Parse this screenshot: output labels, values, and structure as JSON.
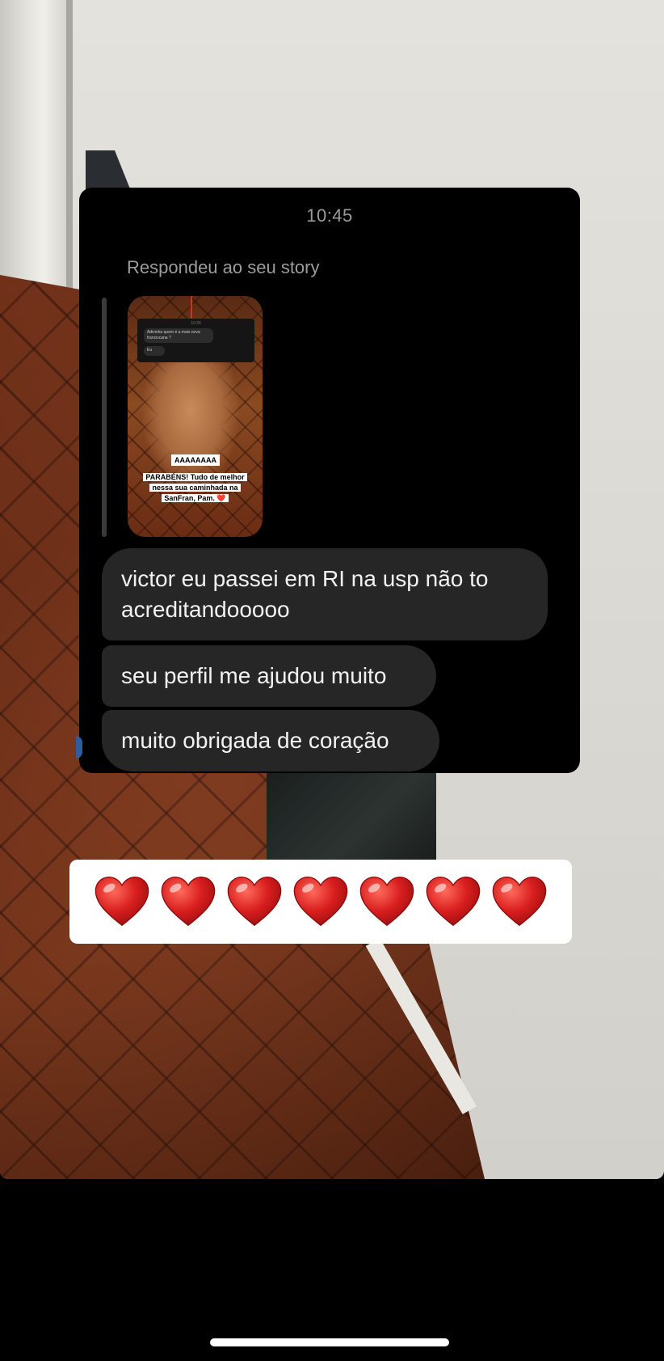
{
  "dm": {
    "time": "10:45",
    "reply_label": "Respondeu ao seu story",
    "story_thumbnail": {
      "dm_time": "10:26",
      "dm_message_1": "Adivinha quem é a mais nova franciscana ?",
      "dm_message_2": "Eu",
      "sticker_1": "AAAAAAAA",
      "sticker_2": "PARABÉNS! Tudo de melhor nessa sua caminhada na SanFran, Pam. ❤️"
    },
    "messages": [
      "victor eu passei em RI na usp não to acreditandooooo",
      "seu perfil me ajudou muito",
      "muito obrigada de coração"
    ]
  },
  "hearts_sticker": {
    "count": 7,
    "glyph": "heart-icon",
    "color": "#d81e1e"
  },
  "colors": {
    "bubble": "#262626",
    "card": "#000000",
    "meta_text": "#9d9d9d"
  }
}
